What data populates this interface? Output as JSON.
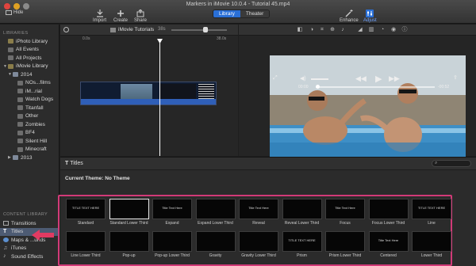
{
  "window": {
    "title": "Markers in iMovie 10.0.4 - Tutorial 45.mp4",
    "hide_label": "Hide",
    "segments": [
      "Library",
      "Theater"
    ],
    "toolbar_left": [
      "Import",
      "Create",
      "Share"
    ],
    "toolbar_right": [
      "Enhance",
      "Adjust"
    ]
  },
  "sidebar": {
    "libraries_header": "LIBRARIES",
    "content_header": "CONTENT LIBRARY",
    "items": [
      {
        "label": "iPhoto Library",
        "icon": "star-icon"
      },
      {
        "label": "All Events",
        "icon": "film-icon"
      },
      {
        "label": "All Projects",
        "icon": "film-icon"
      },
      {
        "label": "iMovie Library",
        "icon": "star-icon"
      },
      {
        "label": "2014",
        "icon": "folder-icon"
      },
      {
        "label": "NOs...films",
        "icon": "film-icon"
      },
      {
        "label": "iM...rial",
        "icon": "film-icon"
      },
      {
        "label": "Watch Dogs",
        "icon": "film-icon"
      },
      {
        "label": "Titanfall",
        "icon": "film-icon"
      },
      {
        "label": "Other",
        "icon": "film-icon"
      },
      {
        "label": "Zombies",
        "icon": "film-icon"
      },
      {
        "label": "BF4",
        "icon": "film-icon"
      },
      {
        "label": "Silent Hill",
        "icon": "film-icon"
      },
      {
        "label": "Minecraft",
        "icon": "film-icon"
      },
      {
        "label": "2013",
        "icon": "folder-icon"
      }
    ],
    "content_items": [
      {
        "label": "Transitions",
        "icon": "transitions-icon"
      },
      {
        "label": "Titles",
        "icon": "titles-icon",
        "selected": true
      },
      {
        "label": "Maps & ...unds",
        "icon": "globe-icon"
      },
      {
        "label": "iTunes",
        "icon": "music-icon"
      },
      {
        "label": "Sound Effects",
        "icon": "speaker-icon"
      }
    ]
  },
  "browser": {
    "project_name": "iMovie Tutorials",
    "duration": "38s",
    "ruler_start": "0.0s",
    "ruler_end": "38.0s"
  },
  "viewer": {
    "time_left": "00:00",
    "time_right": "-00:52"
  },
  "titles_panel": {
    "header": "Titles",
    "theme_label": "Current Theme: No Theme",
    "tiles": [
      {
        "name": "Standard",
        "text": "TITLE TEXT HERE"
      },
      {
        "name": "Standard Lower Third",
        "text": "",
        "selected": true
      },
      {
        "name": "Expand",
        "text": "Title Text Here"
      },
      {
        "name": "Expand Lower Third",
        "text": ""
      },
      {
        "name": "Reveal",
        "text": "Title Text Here"
      },
      {
        "name": "Reveal Lower Third",
        "text": ""
      },
      {
        "name": "Focus",
        "text": "Title Text Here"
      },
      {
        "name": "Focus Lower Third",
        "text": ""
      },
      {
        "name": "Line",
        "text": "TITLE TEXT HERE"
      },
      {
        "name": "Line Lower Third",
        "text": ""
      },
      {
        "name": "Pop-up",
        "text": ""
      },
      {
        "name": "Pop-up Lower Third",
        "text": ""
      },
      {
        "name": "Gravity",
        "text": ""
      },
      {
        "name": "Gravity Lower Third",
        "text": ""
      },
      {
        "name": "Prism",
        "text": "TITLE TEXT HERE"
      },
      {
        "name": "Prism Lower Third",
        "text": ""
      },
      {
        "name": "Centered",
        "text": "Title Text Here"
      },
      {
        "name": "Lower Third",
        "text": ""
      }
    ]
  },
  "colors": {
    "accent": "#2a6fd6",
    "highlight_box": "#d23a78",
    "pointer": "#e23a62"
  }
}
